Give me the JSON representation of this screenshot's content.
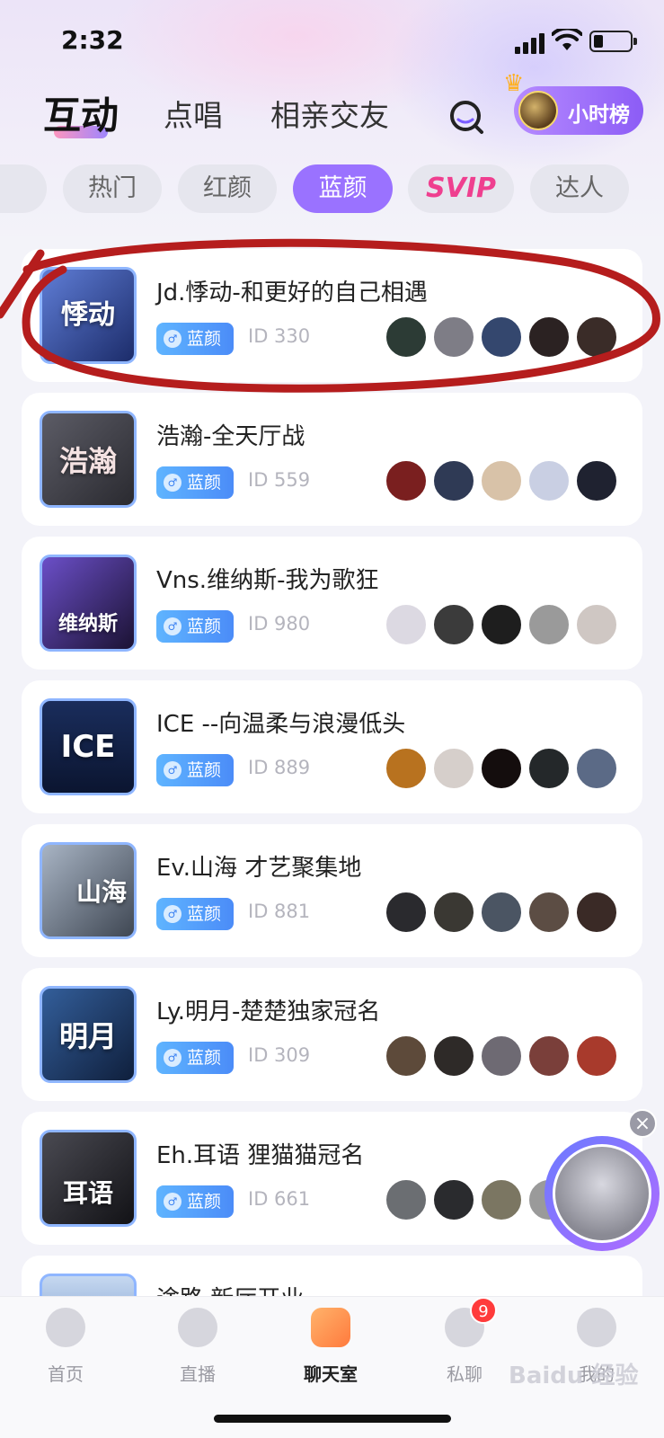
{
  "status_bar": {
    "time": "2:32"
  },
  "top_tabs": [
    {
      "label": "互动",
      "active": true
    },
    {
      "label": "点唱",
      "active": false
    },
    {
      "label": "相亲交友",
      "active": false
    }
  ],
  "rank_button": {
    "label": "小时榜"
  },
  "categories": [
    {
      "label": "热门",
      "active": false
    },
    {
      "label": "红颜",
      "active": false
    },
    {
      "label": "蓝颜",
      "active": true
    },
    {
      "label": "SVIP",
      "active": false
    },
    {
      "label": "达人",
      "active": false
    }
  ],
  "rooms": [
    {
      "title": "Jd.悸动-和更好的自己相遇",
      "tag": "蓝颜",
      "id": "ID 330",
      "cover_text": "悸动",
      "cover_color": "#3a5fae"
    },
    {
      "title": "浩瀚-全天厅战",
      "tag": "蓝颜",
      "id": "ID 559",
      "cover_text": "浩瀚",
      "cover_color": "#4a4a52"
    },
    {
      "title": "Vns.维纳斯-我为歌狂",
      "tag": "蓝颜",
      "id": "ID 980",
      "cover_text": "维纳斯",
      "cover_color": "#2b2a55"
    },
    {
      "title": "ICE --向温柔与浪漫低头",
      "tag": "蓝颜",
      "id": "ID 889",
      "cover_text": "ICE",
      "cover_color": "#13234b"
    },
    {
      "title": "Ev.山海  才艺聚集地",
      "tag": "蓝颜",
      "id": "ID 881",
      "cover_text": "山海",
      "cover_color": "#6b7a8c"
    },
    {
      "title": "Ly.明月-楚楚独家冠名",
      "tag": "蓝颜",
      "id": "ID 309",
      "cover_text": "明月",
      "cover_color": "#1f3f6e"
    },
    {
      "title": "Eh.耳语  狸猫猫冠名",
      "tag": "蓝颜",
      "id": "ID 661",
      "cover_text": "耳语",
      "cover_color": "#2a2a2e"
    },
    {
      "title": "途路  新厅开业",
      "tag": "",
      "id": "",
      "cover_text": "",
      "cover_color": "#7da2d4"
    }
  ],
  "bottom_nav": [
    {
      "label": "首页",
      "icon": "home-icon"
    },
    {
      "label": "直播",
      "icon": "play-icon"
    },
    {
      "label": "聊天室",
      "icon": "chatroom-icon",
      "active": true
    },
    {
      "label": "私聊",
      "icon": "message-icon",
      "badge": "9"
    },
    {
      "label": "我的",
      "icon": "profile-icon"
    }
  ],
  "watermark": "Baidu 经验"
}
